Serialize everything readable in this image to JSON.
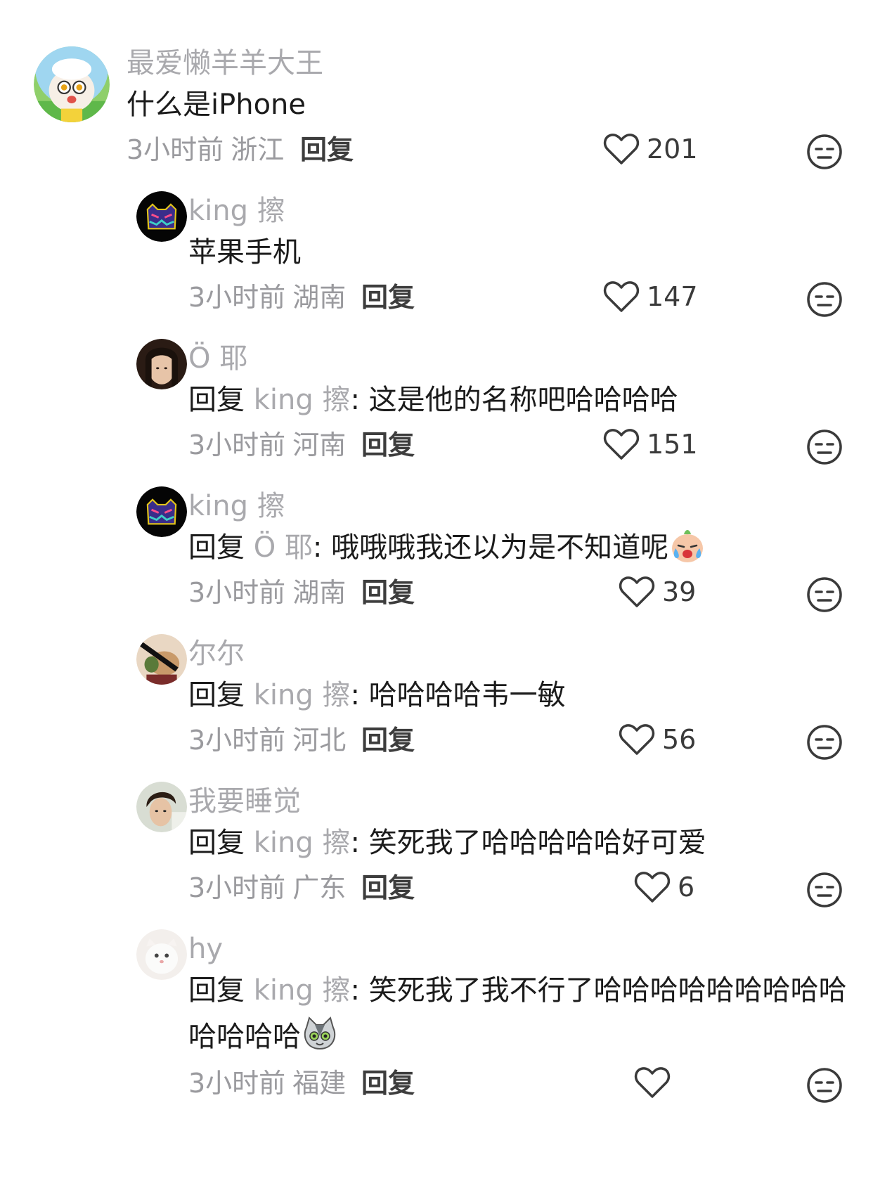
{
  "comments": [
    {
      "name": "最爱懒羊羊大王",
      "text": "什么是iPhone",
      "time": "3小时前",
      "location": "浙江",
      "reply_label": "回复",
      "likes": "201"
    },
    {
      "name": "king 擦",
      "text": "苹果手机",
      "time": "3小时前",
      "location": "湖南",
      "reply_label": "回复",
      "likes": "147"
    },
    {
      "name": "Ö 耶",
      "prefix": "回复",
      "ref": "king 擦",
      "text": ": 这是他的名称吧哈哈哈哈",
      "time": "3小时前",
      "location": "河南",
      "reply_label": "回复",
      "likes": "151"
    },
    {
      "name": "king 擦",
      "prefix": "回复",
      "ref": "Ö 耶",
      "text": ": 哦哦哦我还以为是不知道呢",
      "time": "3小时前",
      "location": "湖南",
      "reply_label": "回复",
      "likes": "39"
    },
    {
      "name": "尔尔",
      "prefix": "回复",
      "ref": "king 擦",
      "text": ": 哈哈哈哈韦一敏",
      "time": "3小时前",
      "location": "河北",
      "reply_label": "回复",
      "likes": "56"
    },
    {
      "name": "我要睡觉",
      "prefix": "回复",
      "ref": "king 擦",
      "text": ": 笑死我了哈哈哈哈哈好可爱",
      "time": "3小时前",
      "location": "广东",
      "reply_label": "回复",
      "likes": "6"
    },
    {
      "name": "hy",
      "prefix": "回复",
      "ref": "king 擦",
      "text": ": 笑死我了我不行了哈哈哈哈哈哈哈哈哈哈哈哈哈",
      "time": "3小时前",
      "location": "福建",
      "reply_label": "回复",
      "likes": ""
    }
  ],
  "colors": {
    "name": "#a9a9ad",
    "text": "#1b1b1b",
    "meta": "#9a9a9e"
  },
  "icons": [
    "heart-outline-icon",
    "dislike-face-icon",
    "crying-emoji-icon",
    "cat-emoji-icon"
  ]
}
